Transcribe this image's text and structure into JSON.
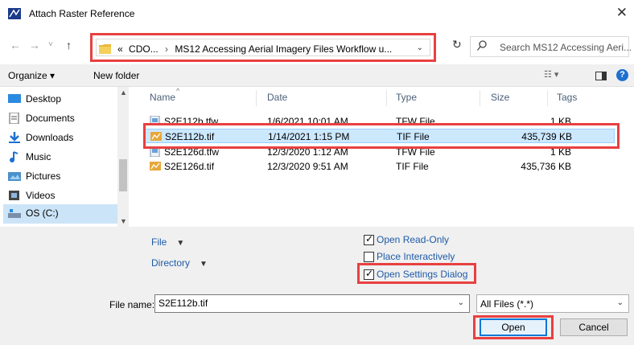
{
  "window": {
    "title": "Attach Raster Reference",
    "close_label": "✕"
  },
  "nav": {
    "back": "←",
    "forward": "→",
    "recent": "˅",
    "up": "↑",
    "refresh": "↻"
  },
  "address": {
    "prefix": "«",
    "segments": [
      "CDO...",
      "MS12 Accessing Aerial Imagery Files Workflow u..."
    ],
    "separator": "›",
    "dropdown": "⌄"
  },
  "search": {
    "placeholder": "Search MS12 Accessing Aeri..."
  },
  "toolbar": {
    "organize": "Organize ▾",
    "new_folder": "New folder",
    "help": "?"
  },
  "sidebar": {
    "items": [
      {
        "label": "Desktop",
        "icon": "desktop-icon"
      },
      {
        "label": "Documents",
        "icon": "documents-icon"
      },
      {
        "label": "Downloads",
        "icon": "downloads-icon"
      },
      {
        "label": "Music",
        "icon": "music-icon"
      },
      {
        "label": "Pictures",
        "icon": "pictures-icon"
      },
      {
        "label": "Videos",
        "icon": "videos-icon"
      },
      {
        "label": "OS (C:)",
        "icon": "drive-icon",
        "selected": true
      }
    ]
  },
  "filelist": {
    "columns": [
      "Name",
      "Date",
      "Type",
      "Size",
      "Tags"
    ],
    "rows": [
      {
        "name": "S2E112b.tfw",
        "date": "1/6/2021 10:01 AM",
        "type": "TFW File",
        "size": "1 KB",
        "icon": "tfw-file-icon"
      },
      {
        "name": "S2E112b.tif",
        "date": "1/14/2021 1:15 PM",
        "type": "TIF File",
        "size": "435,739 KB",
        "icon": "tif-file-icon",
        "selected": true
      },
      {
        "name": "S2E126d.tfw",
        "date": "12/3/2020 1:12 AM",
        "type": "TFW File",
        "size": "1 KB",
        "icon": "tfw-file-icon"
      },
      {
        "name": "S2E126d.tif",
        "date": "12/3/2020 9:51 AM",
        "type": "TIF File",
        "size": "435,736 KB",
        "icon": "tif-file-icon"
      }
    ]
  },
  "options": {
    "file_link": "File",
    "directory_link": "Directory",
    "open_read_only": {
      "label": "Open Read-Only",
      "checked": true
    },
    "place_interactively": {
      "label": "Place Interactively",
      "checked": false
    },
    "open_settings_dialog": {
      "label": "Open Settings Dialog",
      "checked": true
    }
  },
  "filename": {
    "label": "File name:",
    "value": "S2E112b.tif"
  },
  "filetype": {
    "value": "All Files (*.*)"
  },
  "buttons": {
    "open": "Open",
    "cancel": "Cancel"
  },
  "colors": {
    "highlight_outline": "#e84040",
    "selection": "#cce8ff",
    "accent": "#0078d7"
  }
}
